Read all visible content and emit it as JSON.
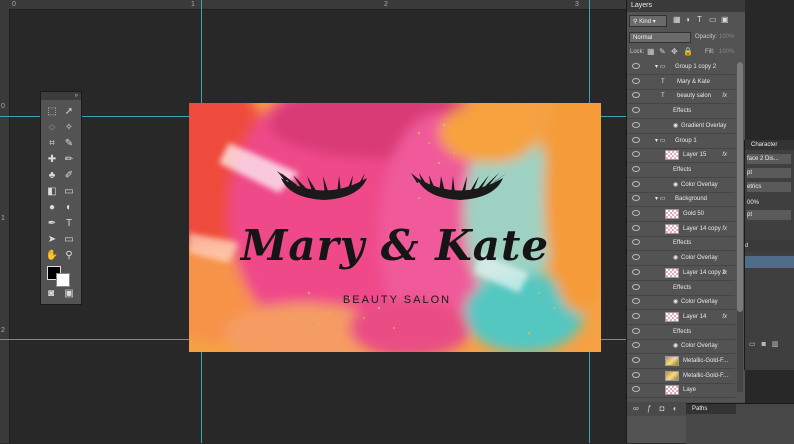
{
  "ruler": {
    "top_labels": [
      "0",
      "1",
      "2",
      "3"
    ],
    "left_labels": [
      "0",
      "1",
      "2"
    ]
  },
  "card": {
    "name": "Mary & Kate",
    "subtitle": "BEAUTY SALON"
  },
  "layers_panel": {
    "tab": "Layers",
    "filter": "Kind",
    "blend_mode": "Normal",
    "opacity_label": "Opacity:",
    "opacity_value": "100%",
    "lock_label": "Lock:",
    "fill_label": "Fill:",
    "fill_value": "100%",
    "layers": [
      {
        "name": "Group 1 copy 2",
        "kind": "group"
      },
      {
        "name": "Mary & Kate",
        "kind": "text"
      },
      {
        "name": "beauty salon",
        "kind": "text",
        "fx": "fx"
      },
      {
        "name": "Effects",
        "kind": "effects"
      },
      {
        "name": "Gradient Overlay",
        "kind": "effect"
      },
      {
        "name": "Group 1",
        "kind": "group"
      },
      {
        "name": "Layer 15",
        "kind": "layer",
        "fx": "fx"
      },
      {
        "name": "Effects",
        "kind": "effects"
      },
      {
        "name": "Color Overlay",
        "kind": "effect"
      },
      {
        "name": "Background",
        "kind": "group"
      },
      {
        "name": "Gold 50",
        "kind": "layer"
      },
      {
        "name": "Layer 14 copy",
        "kind": "layer",
        "fx": "fx"
      },
      {
        "name": "Effects",
        "kind": "effects"
      },
      {
        "name": "Color Overlay",
        "kind": "effect"
      },
      {
        "name": "Layer 14 copy 2",
        "kind": "layer",
        "fx": "fx"
      },
      {
        "name": "Effects",
        "kind": "effects"
      },
      {
        "name": "Color Overlay",
        "kind": "effect"
      },
      {
        "name": "Layer 14",
        "kind": "layer",
        "fx": "fx"
      },
      {
        "name": "Effects",
        "kind": "effects"
      },
      {
        "name": "Color Overlay",
        "kind": "effect"
      },
      {
        "name": "Metallic-Gold-F...",
        "kind": "layer"
      },
      {
        "name": "Metallic-Gold-F...",
        "kind": "layer"
      },
      {
        "name": "Laye",
        "kind": "layer"
      }
    ]
  },
  "character_panel": {
    "tab": "Character",
    "font": "face 2 Dis...",
    "size_unit": "pt",
    "kerning": "etrics",
    "scale": "00%",
    "baseline_unit": "pt",
    "item": "d"
  },
  "paths_panel": {
    "tab": "Paths"
  },
  "colors": {
    "foreground": "#000000",
    "background": "#ffffff",
    "guide": "#39c6d8"
  }
}
